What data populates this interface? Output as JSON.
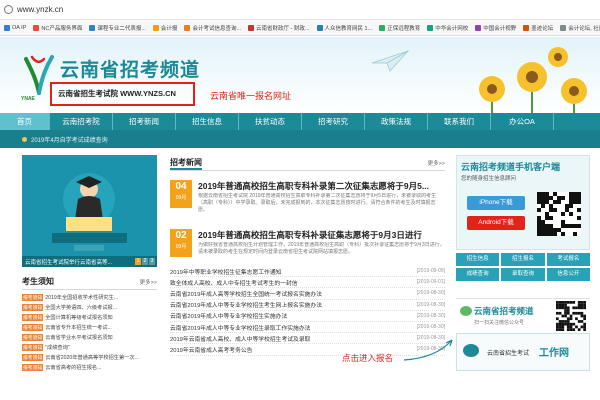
{
  "browser": {
    "url": "www.ynzk.cn",
    "bookmarks": [
      {
        "label": "OA IP",
        "color": "#3a7bd5"
      },
      {
        "label": "NC产品服务界面",
        "color": "#e74c3c"
      },
      {
        "label": "课程专业二代表报...",
        "color": "#2e86c1"
      },
      {
        "label": "会计报",
        "color": "#f39c12"
      },
      {
        "label": "会计考试信息查询...",
        "color": "#e67e22"
      },
      {
        "label": "云南省财政厅 - 财政...",
        "color": "#c0392b"
      },
      {
        "label": "人众信教育网民 1...",
        "color": "#2980b9"
      },
      {
        "label": "正保远程教育",
        "color": "#27ae60"
      },
      {
        "label": "中华会计网校",
        "color": "#16a085"
      },
      {
        "label": "中国会计视野",
        "color": "#8e44ad"
      },
      {
        "label": "墨迹论坛",
        "color": "#d35400"
      },
      {
        "label": "会计论坛, 社区 - ...",
        "color": "#7f8c8d"
      }
    ]
  },
  "banner": {
    "logo_caption": "YNAE",
    "site_title": "云南省招考频道",
    "subtitle": "云南省招生考试院  WWW.YNZS.CN",
    "unique_note": "云南省唯一报名网址"
  },
  "nav": {
    "items": [
      "首页",
      "云南招考院",
      "招考新闻",
      "招生信息",
      "扶贫动态",
      "招考研究",
      "政策法规",
      "联系我们",
      "办公OA"
    ],
    "active_index": 0
  },
  "notice": {
    "text": "2019年4月自学考试成绩查询"
  },
  "hero": {
    "caption": "云南省招生考试院举行云南省高等...",
    "pages": [
      "1",
      "2",
      "3"
    ],
    "current_page": 1
  },
  "exam_tips": {
    "title": "考生须知",
    "more": "更多>>",
    "items": [
      {
        "tag": "报考须知",
        "text": "2019年全国招收学术性研究生..."
      },
      {
        "tag": "报考须知",
        "text": "全国大学英语四、六级考试报..."
      },
      {
        "tag": "报考须知",
        "text": "全国计算机等级考试报名须知"
      },
      {
        "tag": "报考须知",
        "text": "云南省专升本招生统一考试..."
      },
      {
        "tag": "报考须知",
        "text": "云南省学业水平考试报名须知"
      },
      {
        "tag": "报考须知",
        "text": "\"成绩查询\""
      },
      {
        "tag": "报考须知",
        "text": "云南省2020年普通高等学校招生第一次..."
      },
      {
        "tag": "报考须知",
        "text": "云南省高考的招生报名..."
      }
    ]
  },
  "news": {
    "title": "招考新闻",
    "more": "更多>>",
    "featured": [
      {
        "day": "04",
        "month": "09月",
        "title": "2019年普通高校招生高职专科补录第二次征集志愿将于9月5...",
        "desc": "根据云南省招生考试院 2019年普通高校招生高职专科补录第二次征集志愿将于9月5日进行，未被录取的考生（高职（专科））中学录取。录取后，未完成报到的，本次征集志愿按时进行。请符合条件的考生及时填报志愿。"
      },
      {
        "day": "02",
        "month": "09月",
        "title": "2019年普通高校招生高职专科补录征集志愿将于9月3日进行",
        "desc": "为做好我省普通高校招生计划管理工作，2019年普通高校招生高职（专科）批次补录征集志愿将于9月3日进行。请未被录取的考生在规定时间内登录云南省招生考试院网站填报志愿。"
      }
    ],
    "list": [
      {
        "title": "2019年中等职业学校招生征集志愿工作通知",
        "date": "[2019-09-05]"
      },
      {
        "title": "致全体成人高校、成人中专招生考试考生的一封信",
        "date": "[2019-09-01]"
      },
      {
        "title": "云南省2019年成人高等学校招生全国统一考试报名实施办法",
        "date": "[2019-08-30]"
      },
      {
        "title": "云南省2019年成人中等专业学校招生考生网上报名实施办法",
        "date": "[2019-08-30]"
      },
      {
        "title": "云南省2019年成人中等专业学校招生实施办法",
        "date": "[2019-08-30]"
      },
      {
        "title": "云南省2019年成人中等专业学校招生录取工作实施办法",
        "date": "[2019-08-30]"
      },
      {
        "title": "2019年云南省成人高校、成人中等学校招生考试及录取",
        "date": "[2019-08-30]"
      },
      {
        "title": "2019年云南省成人高考考务公告",
        "date": "[2019-08-30]"
      }
    ],
    "click_note": "点击进入报名"
  },
  "app": {
    "title": "云南招考频道手机客户端",
    "subtitle": "您的随身招生信息顾问",
    "ios_label": "iPhone下载",
    "android_label": "Android下载",
    "ios_color": "#3a9ad9",
    "android_color": "#e2231a"
  },
  "quick_links": [
    "招生信息",
    "招生报名",
    "考试报名",
    "成绩查询",
    "录取查询",
    "信息公开"
  ],
  "wechat": {
    "title": "云南省招考频道",
    "subtitle": "扫一扫关注微信公众号"
  },
  "gzh": {
    "label": "云南省招生考试",
    "highlight": "工作网"
  }
}
